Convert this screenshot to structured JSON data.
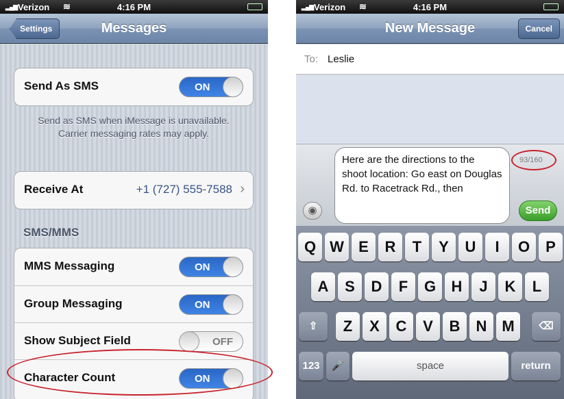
{
  "left": {
    "status": {
      "carrier": "Verizon",
      "time": "4:16 PM"
    },
    "nav": {
      "back": "Settings",
      "title": "Messages"
    },
    "send_as_sms": {
      "label": "Send As SMS",
      "state": "ON"
    },
    "sms_note": "Send as SMS when iMessage is unavailable. Carrier messaging rates may apply.",
    "receive_at": {
      "label": "Receive At",
      "value": "+1 (727) 555-7588"
    },
    "section_header": "SMS/MMS",
    "rows": [
      {
        "label": "MMS Messaging",
        "state": "ON"
      },
      {
        "label": "Group Messaging",
        "state": "ON"
      },
      {
        "label": "Show Subject Field",
        "state": "OFF"
      },
      {
        "label": "Character Count",
        "state": "ON"
      }
    ]
  },
  "right": {
    "status": {
      "carrier": "Verizon",
      "time": "4:16 PM"
    },
    "nav": {
      "title": "New Message",
      "cancel": "Cancel"
    },
    "to_label": "To:",
    "recipient": "Leslie",
    "message": "Here are the directions to the shoot location: Go east on Douglas Rd. to Racetrack Rd., then",
    "char_count": "93/160",
    "send": "Send",
    "keyboard": {
      "row1": [
        "Q",
        "W",
        "E",
        "R",
        "T",
        "Y",
        "U",
        "I",
        "O",
        "P"
      ],
      "row2": [
        "A",
        "S",
        "D",
        "F",
        "G",
        "H",
        "J",
        "K",
        "L"
      ],
      "row3": [
        "Z",
        "X",
        "C",
        "V",
        "B",
        "N",
        "M"
      ],
      "numbers": "123",
      "space": "space",
      "return": "return"
    }
  },
  "colors": {
    "highlight": "#c8222c",
    "switch_on": "#2a67c6",
    "send": "#3a9e2a"
  }
}
